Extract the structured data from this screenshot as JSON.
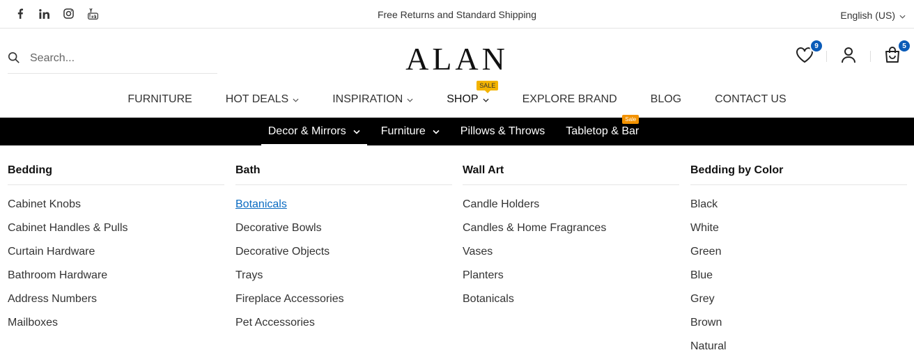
{
  "topbar": {
    "social_icons": [
      "facebook-icon",
      "linkedin-icon",
      "instagram-icon",
      "youtube-icon"
    ],
    "announcement": "Free Returns and Standard Shipping",
    "language": "English (US)"
  },
  "header": {
    "search_placeholder": "Search...",
    "logo": "ALAN",
    "wishlist_count": "9",
    "cart_count": "5"
  },
  "mainnav": {
    "items": [
      "FURNITURE",
      "HOT DEALS",
      "INSPIRATION",
      "SHOP",
      "EXPLORE BRAND",
      "BLOG",
      "CONTACT US"
    ],
    "shop_badge": "SALE"
  },
  "subnav": {
    "items": [
      "Decor & Mirrors",
      "Furniture",
      "Pillows & Throws",
      "Tabletop & Bar"
    ],
    "tabletop_badge": "Sale"
  },
  "mega": {
    "columns": [
      {
        "title": "Bedding",
        "links": [
          "Cabinet Knobs",
          "Cabinet Handles & Pulls",
          "Curtain Hardware",
          "Bathroom Hardware",
          "Address Numbers",
          "Mailboxes"
        ]
      },
      {
        "title": "Bath",
        "links": [
          "Botanicals",
          "Decorative Bowls",
          "Decorative Objects",
          "Trays",
          "Fireplace Accessories",
          "Pet Accessories"
        ]
      },
      {
        "title": "Wall Art",
        "links": [
          "Candle Holders",
          "Candles & Home Fragrances",
          "Vases",
          "Planters",
          "Botanicals"
        ]
      },
      {
        "title": "Bedding by Color",
        "links": [
          "Black",
          "White",
          "Green",
          "Blue",
          "Grey",
          "Brown",
          "Natural"
        ]
      }
    ]
  },
  "colors": {
    "accent": "#0a5bb8",
    "sale": "#f3b300",
    "subbar": "#000000",
    "link": "#0a6bc2"
  }
}
